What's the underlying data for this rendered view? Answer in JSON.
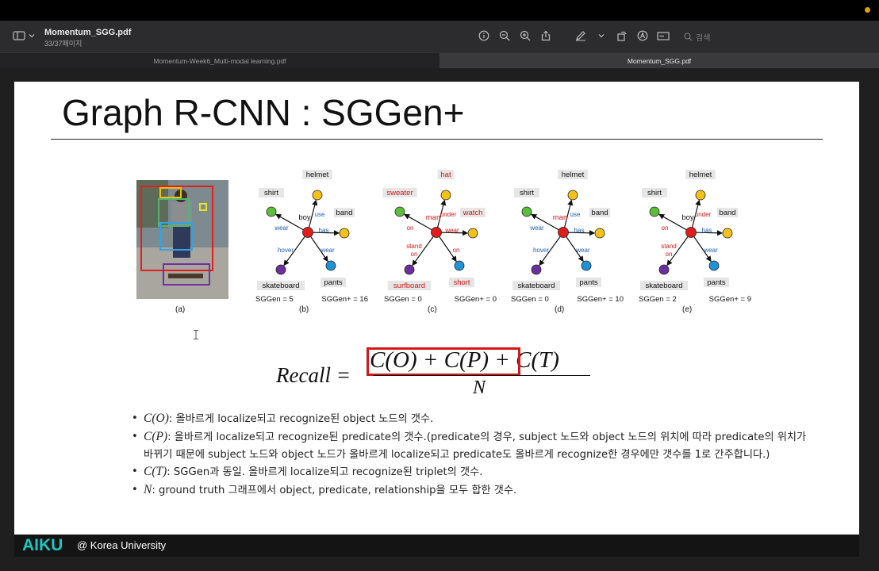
{
  "window": {
    "doc_title": "Momentum_SGG.pdf",
    "page_info": "33/37페이지",
    "search_placeholder": "검색"
  },
  "tabs": [
    {
      "label": "Momentum-Week6_Multi-modal learning.pdf",
      "active": false
    },
    {
      "label": "Momentum_SGG.pdf",
      "active": true
    }
  ],
  "slide": {
    "title": "Graph R-CNN : SGGen+",
    "figures": {
      "a_label": "(a)",
      "graphs": [
        {
          "id": "b",
          "caption": "(b)",
          "sggen": "SGGen = 5",
          "sggen_plus": "SGGen+ = 16",
          "center": "boy",
          "top": "helmet",
          "left": "shirt",
          "right": "band",
          "bl": "skateboard",
          "br": "pants",
          "e_top": "use",
          "e_left": "wear",
          "e_right": "has",
          "e_bl": "hover",
          "e_br": "wear",
          "red_words": []
        },
        {
          "id": "c",
          "caption": "(c)",
          "sggen": "SGGen = 0",
          "sggen_plus": "SGGen+ = 0",
          "center": "man",
          "top": "hat",
          "left": "sweater",
          "right": "watch",
          "bl": "surfboard",
          "br": "short",
          "e_top": "under",
          "e_left": "on",
          "e_right": "wear",
          "e_bl": "stand on",
          "e_br": "on",
          "red_words": [
            "center",
            "top",
            "left",
            "right",
            "bl",
            "br",
            "e_top",
            "e_left",
            "e_right",
            "e_bl",
            "e_br"
          ]
        },
        {
          "id": "d",
          "caption": "(d)",
          "sggen": "SGGen = 0",
          "sggen_plus": "SGGen+ = 10",
          "center": "man",
          "top": "helmet",
          "left": "shirt",
          "right": "band",
          "bl": "skateboard",
          "br": "pants",
          "e_top": "use",
          "e_left": "wear",
          "e_right": "has",
          "e_bl": "hover",
          "e_br": "wear",
          "red_words": [
            "center"
          ]
        },
        {
          "id": "e",
          "caption": "(e)",
          "sggen": "SGGen = 2",
          "sggen_plus": "SGGen+ = 9",
          "center": "boy",
          "top": "helmet",
          "left": "shirt",
          "right": "band",
          "bl": "skateboard",
          "br": "pants",
          "e_top": "under",
          "e_left": "on",
          "e_right": "has",
          "e_bl": "stand on",
          "e_br": "wear",
          "red_words": [
            "e_top",
            "e_left",
            "e_bl"
          ]
        }
      ]
    },
    "equation": {
      "lhs": "Recall =",
      "numerator": "C(O) + C(P) + C(T)",
      "denominator": "N"
    },
    "bullets": [
      {
        "math": "C(O)",
        "text": ": 올바르게 localize되고 recognize된 object 노드의 갯수."
      },
      {
        "math": "C(P)",
        "text": ": 올바르게 localize되고 recognize된 predicate의 갯수.(predicate의 경우, subject 노드와 object 노드의 위치에 따라 predicate의 위치가 바뀌기 때문에 subject 노드와 object 노드가 올바르게 localize되고 predicate도 올바르게 recognize한 경우에만 갯수를 1로 간주합니다.)"
      },
      {
        "math": "C(T)",
        "text": ": SGGen과 동일. 올바르게 localize되고 recognize된 triplet의 갯수."
      },
      {
        "math": "N",
        "text": ": ground truth 그래프에서 object, predicate, relationship을 모두 합한 갯수."
      }
    ]
  },
  "footer": {
    "brand": "AIKU",
    "affiliation": "@ Korea University"
  },
  "colors": {
    "accent_teal": "#19c8c0",
    "highlight_red": "#d31818",
    "node_red": "#e11c1c",
    "node_yellow": "#f2c21a",
    "node_green": "#5dbd3c",
    "node_purple": "#6b2fa0",
    "node_blue": "#1e93d6"
  }
}
